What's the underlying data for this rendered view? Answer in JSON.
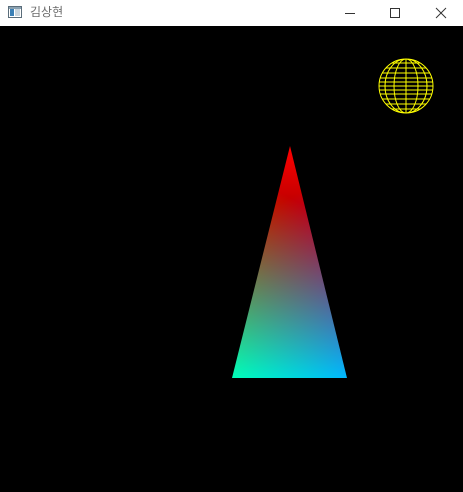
{
  "window": {
    "title": "김상현",
    "controls": {
      "minimize_icon": "minimize-icon",
      "maximize_icon": "maximize-icon",
      "close_icon": "close-icon"
    }
  },
  "scene": {
    "background": "#000000",
    "triangle": {
      "vertex_colors": {
        "top": "#ff0000",
        "bottom_left": "#00ff00",
        "bottom_right": "#0000ff"
      }
    },
    "sphere": {
      "style": "wireframe",
      "color": "#ffff00"
    }
  }
}
